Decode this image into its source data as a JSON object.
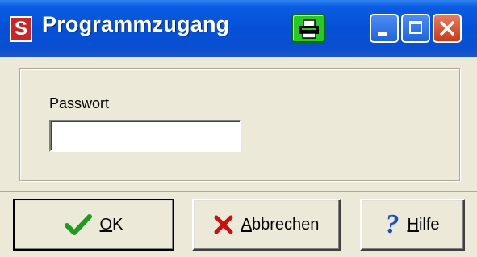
{
  "window": {
    "title": "Programmzugang",
    "app_icon_letter": "S"
  },
  "form": {
    "password_label": "Passwort",
    "password_value": ""
  },
  "buttons": {
    "ok": "OK",
    "cancel": "Abbrechen",
    "help": "Hilfe"
  },
  "icons": {
    "app": "s-logo-icon",
    "print": "printer-icon",
    "ok": "checkmark-icon",
    "cancel": "red-x-icon",
    "help": "question-mark-icon"
  },
  "colors": {
    "titlebar": "#0a5ce2",
    "dialog_bg": "#ece9d8",
    "print_button": "#28c828",
    "close_button": "#c63a1a",
    "checkmark": "#1e9a1e",
    "cross": "#c81010",
    "help": "#1850c8"
  }
}
